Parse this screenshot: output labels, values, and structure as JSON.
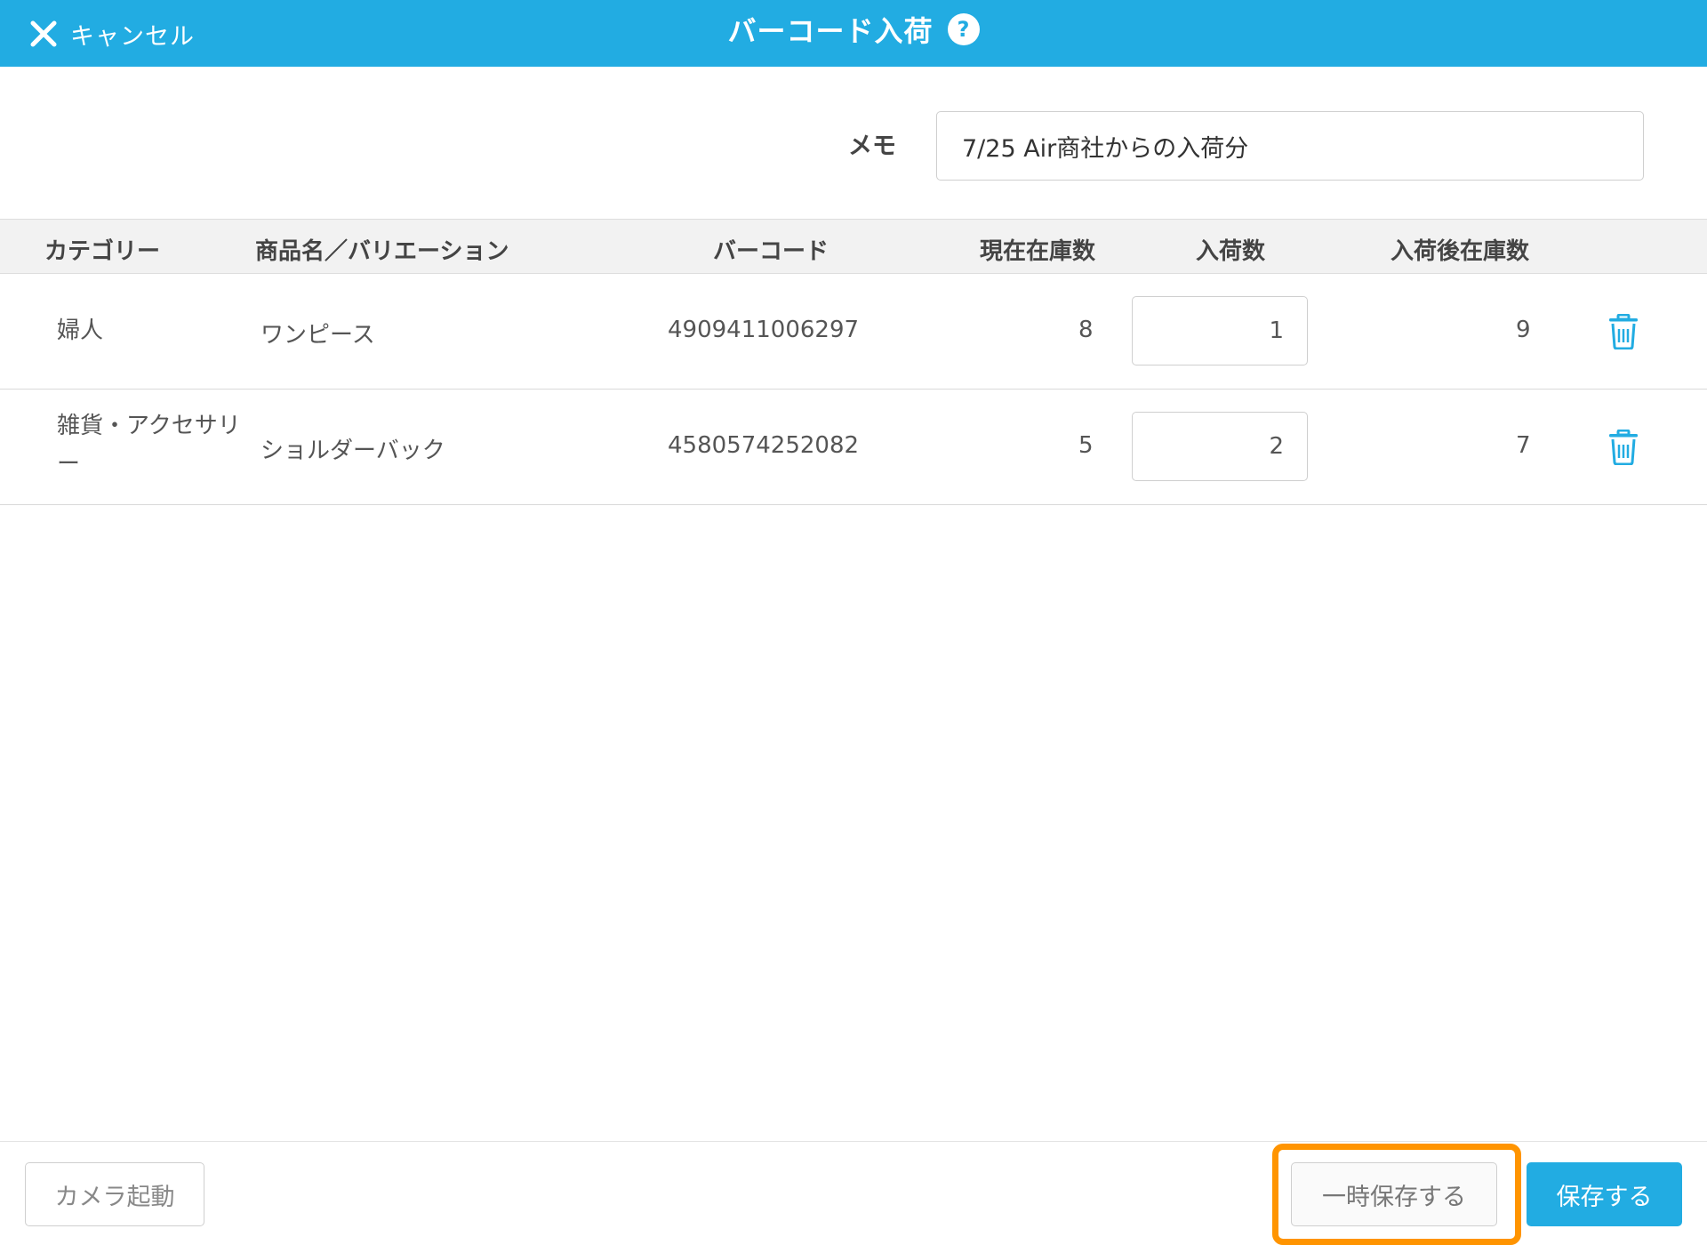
{
  "header": {
    "cancel_label": "キャンセル",
    "title": "バーコード入荷",
    "help_glyph": "?"
  },
  "memo": {
    "label": "メモ",
    "value": "7/25 Air商社からの入荷分"
  },
  "table": {
    "columns": [
      "カテゴリー",
      "商品名／バリエーション",
      "バーコード",
      "現在在庫数",
      "入荷数",
      "入荷後在庫数"
    ],
    "rows": [
      {
        "category": "婦人",
        "product": "ワンピース",
        "barcode": "4909411006297",
        "current_stock": "8",
        "incoming": "1",
        "after_stock": "9"
      },
      {
        "category": "雑貨・アクセサリー",
        "product": "ショルダーバック",
        "barcode": "4580574252082",
        "current_stock": "5",
        "incoming": "2",
        "after_stock": "7"
      }
    ]
  },
  "footer": {
    "camera_label": "カメラ起動",
    "temp_save_label": "一時保存する",
    "save_label": "保存する"
  },
  "icons": {
    "cancel": "close-icon",
    "help": "help-icon",
    "delete": "trash-icon"
  },
  "colors": {
    "brand": "#22ace2",
    "highlight": "#ff9400"
  }
}
